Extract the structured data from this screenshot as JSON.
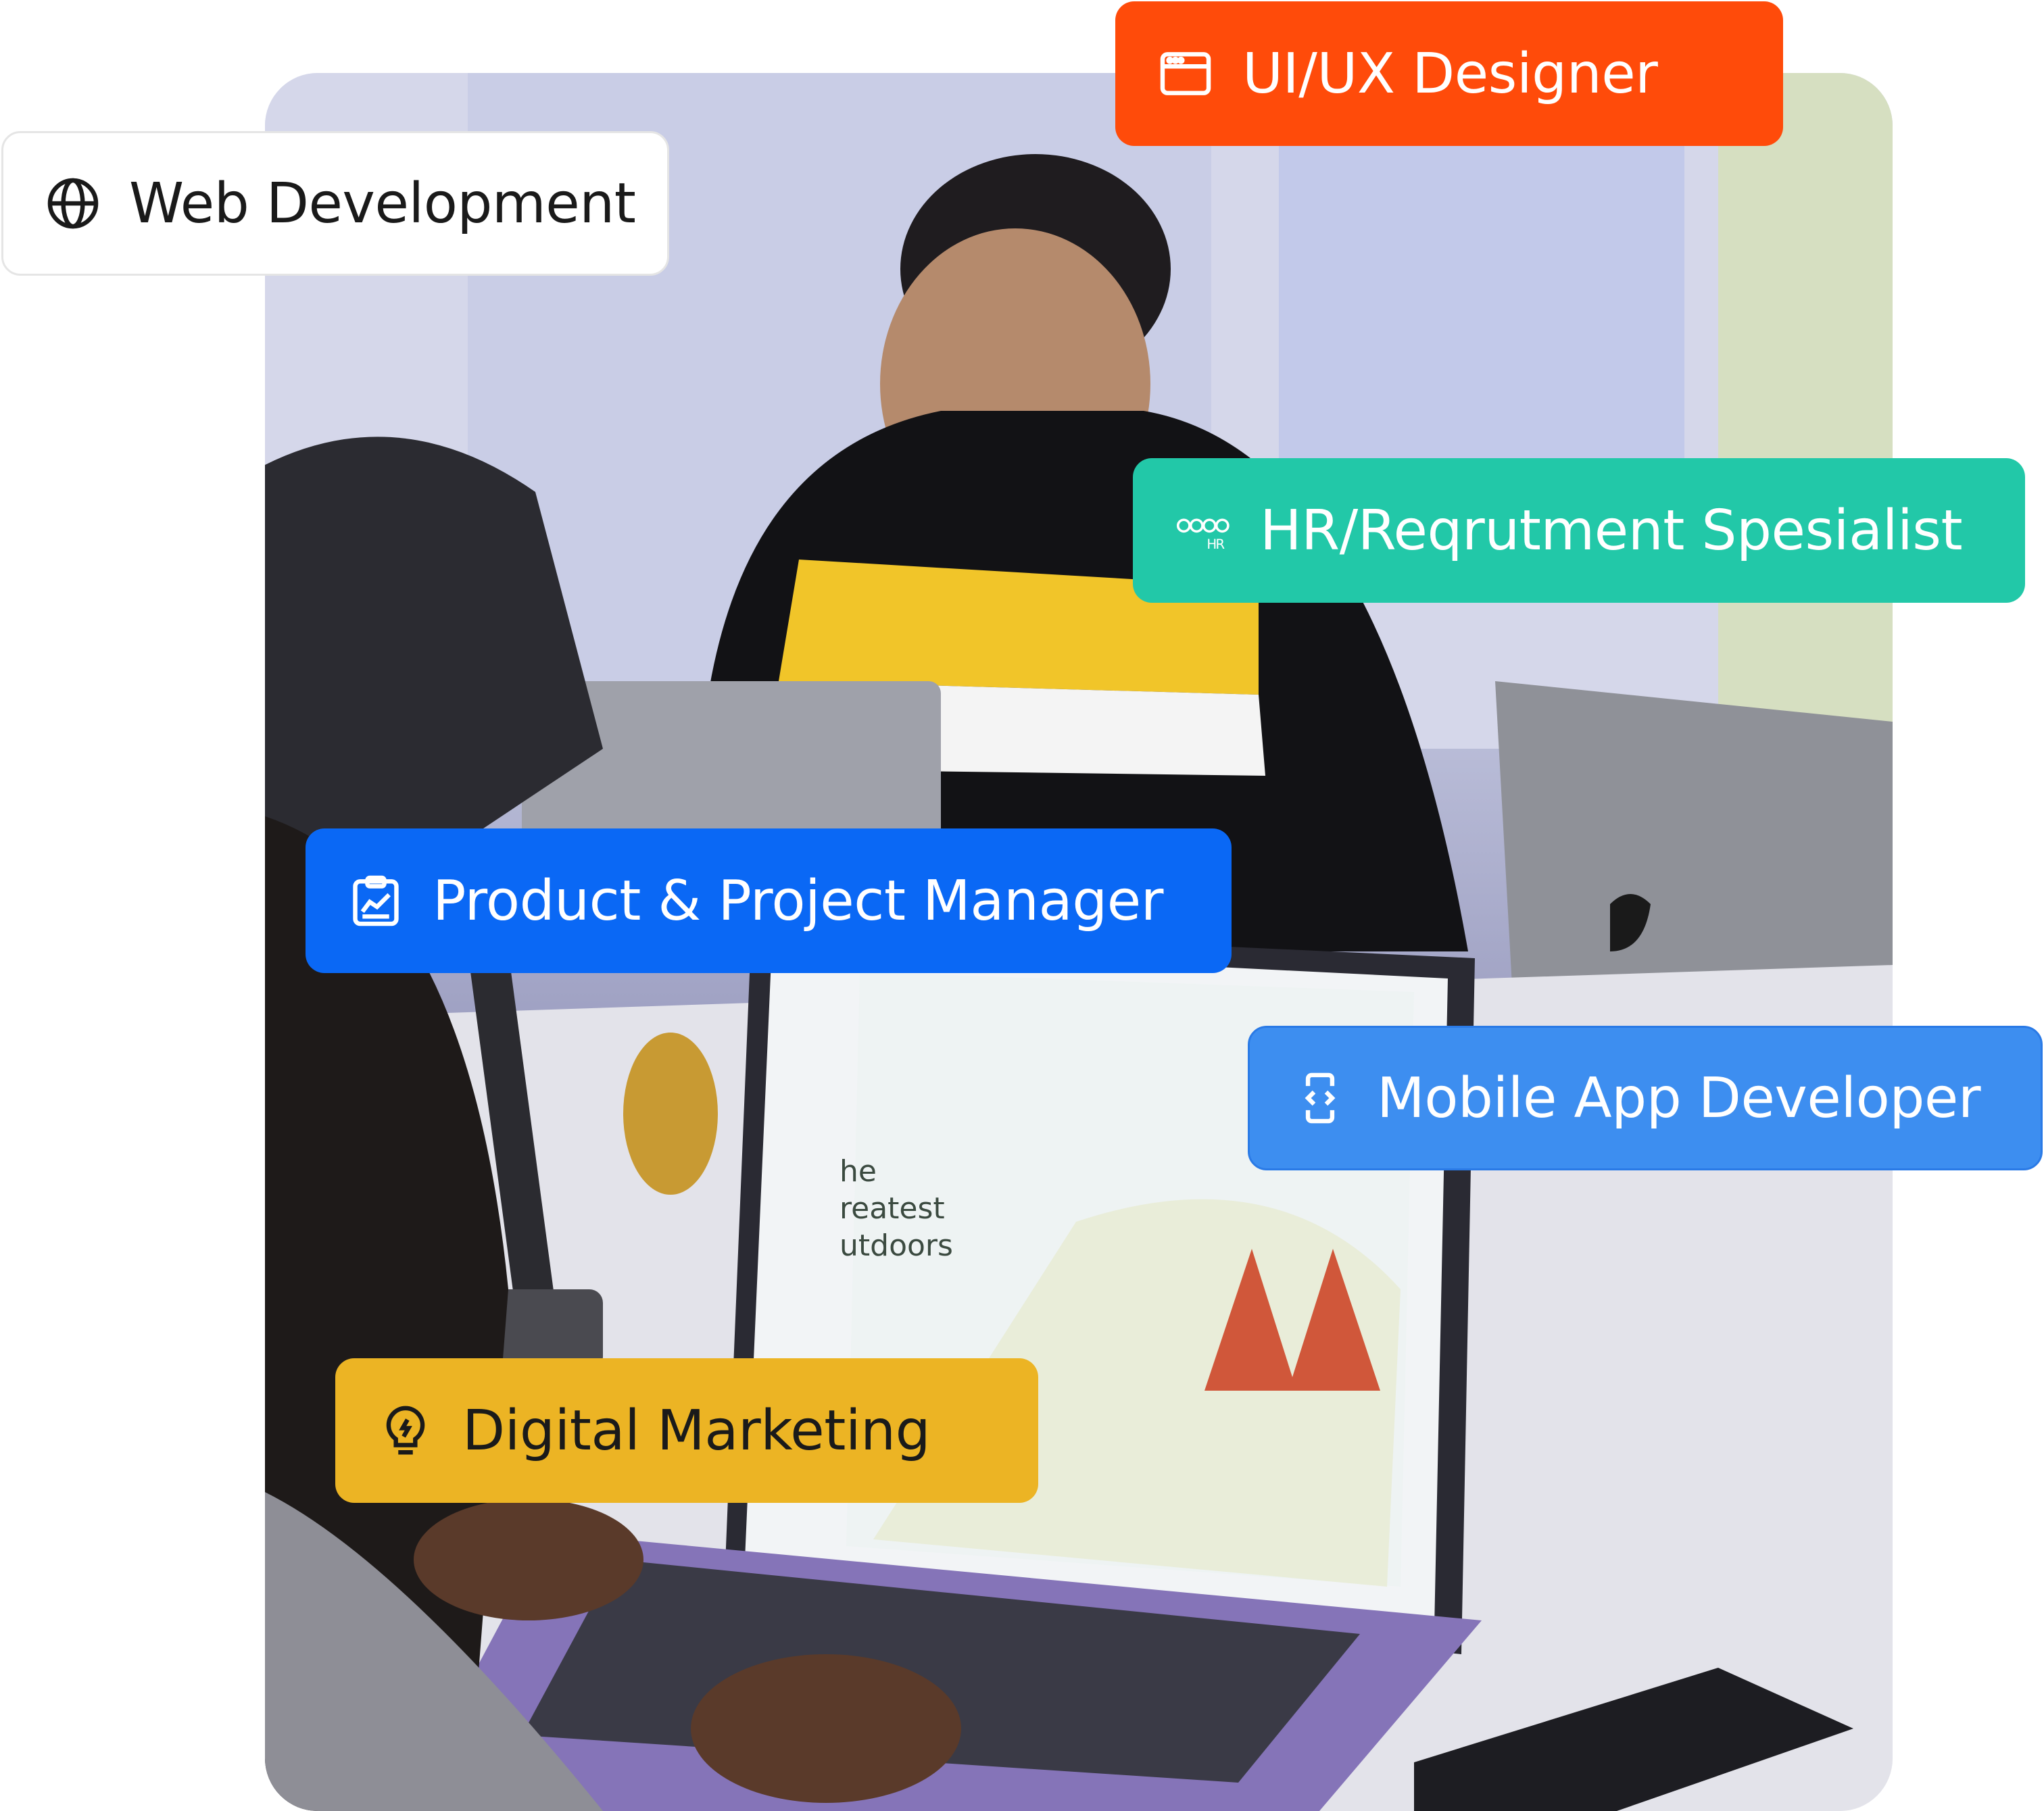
{
  "chips": {
    "web": {
      "label": "Web Development",
      "icon": "globe-icon",
      "bg": "#ffffff",
      "color": "#1a1a1a"
    },
    "uiux": {
      "label": "UI/UX Designer",
      "icon": "browser-window-icon",
      "bg": "#ff4b0a",
      "color": "#ffffff"
    },
    "hr": {
      "label": "HR/Reqrutment Spesialist",
      "icon": "hr-team-icon",
      "icon_text": "HR",
      "bg": "#22c8a8",
      "color": "#ffffff"
    },
    "pm": {
      "label": "Product & Project Manager",
      "icon": "clipboard-chart-icon",
      "bg": "#0a68f5",
      "color": "#ffffff"
    },
    "mobile": {
      "label": "Mobile App Developer",
      "icon": "mobile-code-icon",
      "bg": "#3d8ef0",
      "color": "#ffffff"
    },
    "dm": {
      "label": "Digital Marketing",
      "icon": "lightbulb-icon",
      "bg": "#ecb424",
      "color": "#1a1a1a"
    }
  },
  "photo": {
    "screen_text": [
      "he",
      "reatest",
      "utdoors"
    ]
  }
}
